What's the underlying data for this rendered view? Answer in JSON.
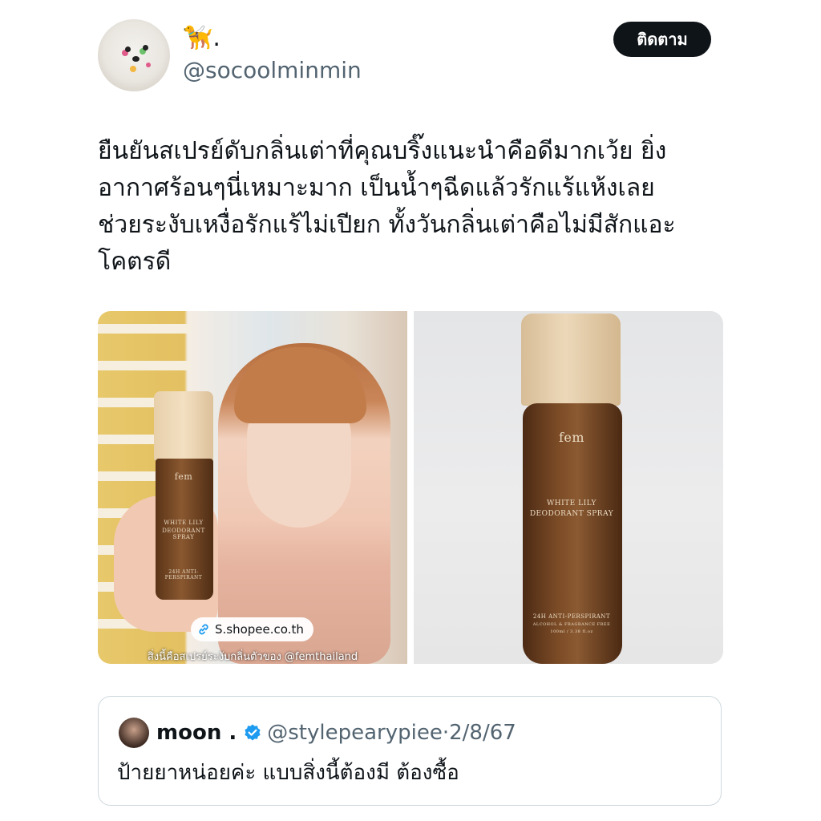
{
  "author": {
    "display_name": "🦮.",
    "handle": "@socoolminmin"
  },
  "follow_label": "ติดตาม",
  "tweet_lines": [
    "ยืนยันสเปรย์ดับกลิ่นเต่าที่คุณบริ๊งแนะนำคือดีมากเว้ย ยิ่ง",
    "อากาศร้อนๆนี่เหมาะมาก เป็นน้ำๆฉีดแล้วรักแร้แห้งเลย",
    "ช่วยระงับเหงื่อรักแร้ไม่เปียก ทั้งวันกลิ่นเต่าคือไม่มีสักแอะ",
    "โคตรดี"
  ],
  "media": {
    "left": {
      "link_chip": "S.shopee.co.th",
      "caption": "สิ่งนี้คือสเปรย์ระงับกลิ่นตัวของ @femthailand",
      "bottle_text": [
        "fem",
        "WHITE LILY",
        "DEODORANT SPRAY",
        "24H ANTI-PERSPIRANT"
      ]
    },
    "right": {
      "bottle_text": [
        "fem",
        "WHITE LILY",
        "DEODORANT SPRAY",
        "24H ANTI-PERSPIRANT",
        "ALCOHOL & FRAGRANCE FREE",
        "100ml / 3.38 fl.oz"
      ]
    }
  },
  "quote": {
    "name": "moon .",
    "handle": "@stylepearypiee",
    "separator": "·",
    "date": "2/8/67",
    "text": "ป้ายยาหน่อยค่ะ แบบสิ่งนี้ต้องมี ต้องซื้อ"
  },
  "colors": {
    "verified": "#1d9bf0",
    "follow_bg": "#0f1419",
    "secondary_text": "#536471"
  }
}
